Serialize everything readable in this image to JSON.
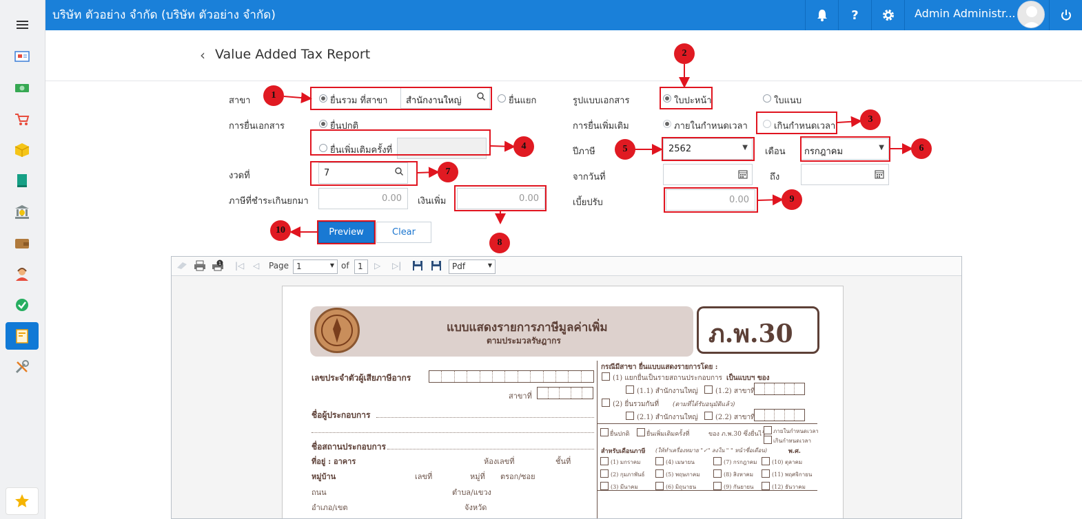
{
  "header": {
    "company": "บริษัท ตัวอย่าง จำกัด (บริษัท ตัวอย่าง จำกัด)",
    "user": "Admin Administr...",
    "help": "?"
  },
  "page": {
    "title": "Value Added Tax Report"
  },
  "form": {
    "branch_label": "สาขา",
    "branch_combined": "ยื่นรวม ที่สาขา",
    "branch_value": "สำนักงานใหญ่",
    "branch_separate": "ยื่นแยก",
    "doc_format_label": "รูปแบบเอกสาร",
    "doc_cover": "ใบปะหน้า",
    "doc_attach": "ใบแนบ",
    "filing_label": "การยื่นเอกสาร",
    "filing_normal": "ยื่นปกติ",
    "filing_extra": "ยื่นเพิ่มเติมครั้งที่",
    "extra_label": "การยื่นเพิ่มเติม",
    "extra_ontime": "ภายในกำหนดเวลา",
    "extra_late": "เกินกำหนดเวลา",
    "year_label": "ปีภาษี",
    "year_value": "2562",
    "month_label": "เดือน",
    "month_value": "กรกฎาคม",
    "period_label": "งวดที่",
    "period_value": "7",
    "from_label": "จากวันที่",
    "to_label": "ถึง",
    "carry_label": "ภาษีที่ชำระเกินยกมา",
    "carry_value": "0.00",
    "surcharge_label": "เงินเพิ่ม",
    "surcharge_value": "0.00",
    "penalty_label": "เบี้ยปรับ",
    "penalty_value": "0.00",
    "preview": "Preview",
    "clear": "Clear"
  },
  "markers": [
    "1",
    "2",
    "3",
    "4",
    "5",
    "6",
    "7",
    "8",
    "9",
    "10"
  ],
  "viewer": {
    "page_label": "Page",
    "page_value": "1",
    "of_label": "of",
    "total_pages": "1",
    "format": "Pdf"
  },
  "report": {
    "heading": "แบบแสดงรายการภาษีมูลค่าเพิ่ม",
    "subheading": "ตามประมวลรัษฎากร",
    "form_code": "ภ.พ.30",
    "tin_label": "เลขประจำตัวผู้เสียภาษีอากร",
    "branch_no": "สาขาที่",
    "operator": "ชื่อผู้ประกอบการ",
    "establishment": "ชื่อสถานประกอบการ",
    "address": "ที่อยู่ : อาคาร",
    "room": "ห้องเลขที่",
    "floor": "ชั้นที่",
    "village": "หมู่บ้าน",
    "number": "เลขที่",
    "moo": "หมู่ที่",
    "soi": "ตรอก/ซอย",
    "road": "ถนน",
    "subdistrict": "ตำบล/แขวง",
    "district": "อำเภอ/เขต",
    "province": "จังหวัด",
    "branch_case": "กรณีมีสาขา ยื่นแบบแสดงรายการโดย :",
    "opt1": "(1) แยกยื่นเป็นรายสถานประกอบการ",
    "opt1b": "เป็นแบบฯ ของ",
    "opt11": "(1.1) สำนักงานใหญ่",
    "opt12": "(1.2) สาขาที่",
    "opt2": "(2) ยื่นรวมกันที่",
    "opt2b": "(ตามที่ได้รับอนุมัติแล้ว)",
    "opt21": "(2.1) สำนักงานใหญ่",
    "opt22": "(2.2) สาขาที่",
    "normal": "ยื่นปกติ",
    "extra": "ยื่นเพิ่มเติมครั้งที่",
    "extra_of": "ของ ภ.พ.30 ซึ่งยื่นไว้",
    "ontime": "ภายในกำหนดเวลา",
    "late": "เกินกำหนดเวลา",
    "month_for": "สำหรับเดือนภาษี",
    "mark_hint": "(ให้ทำเครื่องหมาย \"✓\" ลงใน \" \" หน้าชื่อเดือน)",
    "be": "พ.ศ.",
    "months": [
      "(1) มกราคม",
      "(4) เมษายน",
      "(7) กรกฎาคม",
      "(10) ตุลาคม",
      "(2) กุมภาพันธ์",
      "(5) พฤษภาคม",
      "(8) สิงหาคม",
      "(11) พฤศจิกายน",
      "(3) มีนาคม",
      "(6) มิถุนายน",
      "(9) กันยายน",
      "(12) ธันวาคม"
    ]
  }
}
